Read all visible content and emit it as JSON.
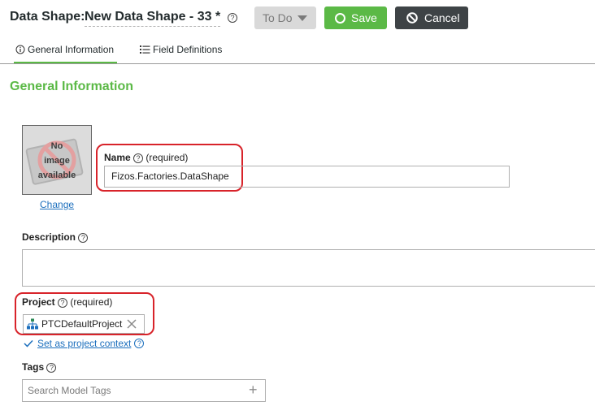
{
  "header": {
    "type_label": "Data Shape:",
    "entity_name": "New Data Shape - 33 *",
    "state_button": "To Do",
    "save_label": "Save",
    "cancel_label": "Cancel"
  },
  "tabs": [
    {
      "label": "General Information",
      "active": true
    },
    {
      "label": "Field Definitions",
      "active": false
    }
  ],
  "section_title": "General Information",
  "image": {
    "placeholder_text": "No image available",
    "change_link": "Change"
  },
  "fields": {
    "name": {
      "label": "Name",
      "required_text": "(required)",
      "value": "Fizos.Factories.DataShape"
    },
    "description": {
      "label": "Description",
      "value": ""
    },
    "project": {
      "label": "Project",
      "required_text": "(required)",
      "value": "PTCDefaultProject",
      "context_link": "Set as project context"
    },
    "tags": {
      "label": "Tags",
      "placeholder": "Search Model Tags"
    }
  },
  "colors": {
    "accent": "#5bb946",
    "highlight": "#d8232a",
    "link": "#1c6fbd",
    "dark_button": "#3e4346"
  },
  "icons": [
    "help-icon",
    "caret-down-icon",
    "circle-icon",
    "ban-icon",
    "info-icon",
    "list-icon",
    "hierarchy-icon",
    "clear-icon",
    "check-icon",
    "plus-icon"
  ]
}
